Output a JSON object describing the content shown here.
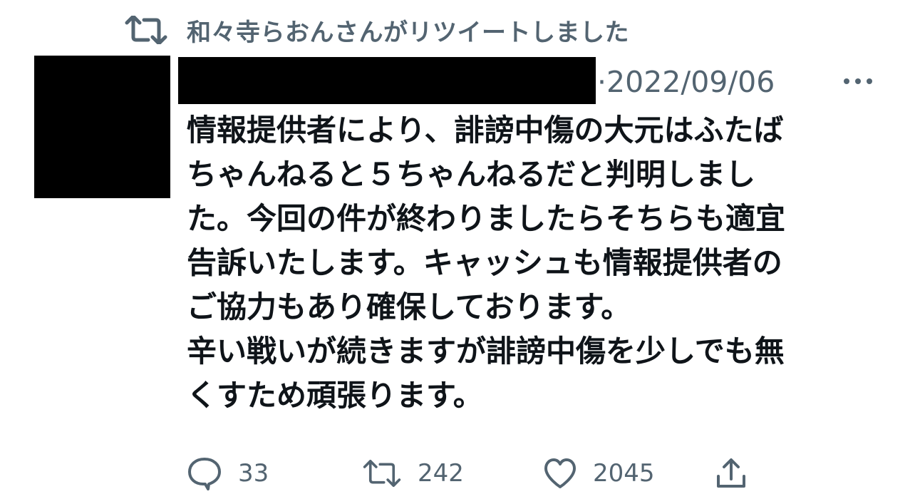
{
  "retweet_header": {
    "text": "和々寺らおんさんがリツイートしました",
    "icon": "retweet-icon"
  },
  "tweet": {
    "date": "·2022/09/06",
    "more_icon": "more-horizontal-icon",
    "text": "情報提供者により、誹謗中傷の大元はふたば\nちゃんねると５ちゃんねるだと判明しまし\nた。今回の件が終わりましたらそちらも適宜\n告訴いたします。キャッシュも情報提供者の\nご協力もあり確保しております。\n辛い戦いが続きますが誹謗中傷を少しでも無\nくすため頑張ります。"
  },
  "actions": {
    "reply": {
      "icon": "reply-icon",
      "count": "33"
    },
    "retweet": {
      "icon": "retweet-icon",
      "count": "242"
    },
    "like": {
      "icon": "heart-icon",
      "count": "2045"
    },
    "share": {
      "icon": "share-icon"
    }
  },
  "colors": {
    "text": "#0f1419",
    "secondary": "#536471",
    "redaction": "#000000"
  }
}
